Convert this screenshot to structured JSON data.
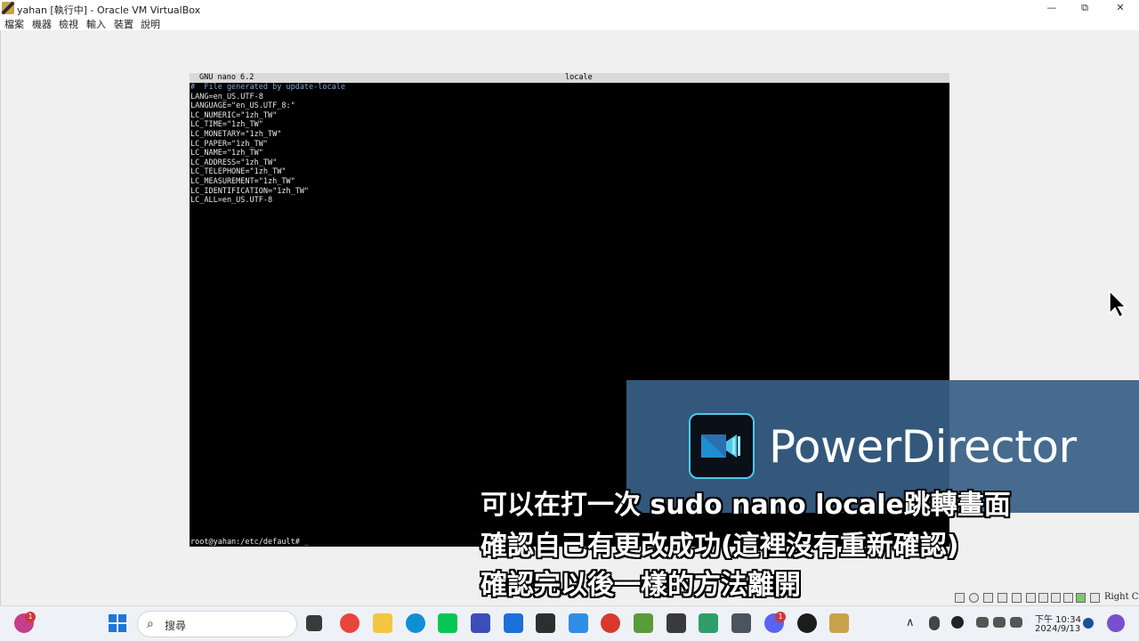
{
  "window": {
    "title": "yahan [執行中] - Oracle VM VirtualBox",
    "minimize_icon": "minimize-icon",
    "restore_icon": "restore-icon",
    "close_icon": "close-icon",
    "minimize_glyph": "—",
    "restore_glyph": "⧉",
    "close_glyph": "✕"
  },
  "menu": [
    "檔案",
    "機器",
    "檢視",
    "輸入",
    "裝置",
    "說明"
  ],
  "nano": {
    "version": "GNU nano 6.2",
    "filename": "locale",
    "lines": [
      "#  File generated by update-locale",
      "LANG=en_US.UTF-8",
      "LANGUAGE=\"en_US.UTF_8:\"",
      "LC_NUMERIC=\"1zh_TW\"",
      "LC_TIME=\"1zh_TW\"",
      "LC_MONETARY=\"1zh_TW\"",
      "LC_PAPER=\"1zh_TW\"",
      "LC_NAME=\"1zh_TW\"",
      "LC_ADDRESS=\"1zh_TW\"",
      "LC_TELEPHONE=\"1zh_TW\"",
      "LC_MEASUREMENT=\"1zh_TW\"",
      "LC_IDENTIFICATION=\"1zh_TW\"",
      "LC_ALL=en_US.UTF-8"
    ],
    "prompt": "root@yahan:/etc/default# _"
  },
  "watermark": {
    "brand": "PowerDirector"
  },
  "subtitles": [
    "可以在打一次 sudo nano locale跳轉畫面",
    "確認自己有更改成功(這裡沒有重新確認)",
    "確認完以後一樣的方法離開"
  ],
  "vbox_status": {
    "host_key": "Right Ctrl"
  },
  "taskbar": {
    "search_placeholder": "搜尋",
    "search_glyph": "⌕",
    "chat_badge": "1",
    "discord_badge": "1",
    "tray_up_glyph": "∧",
    "tray_time": "下午 10:34",
    "tray_date": "2024/9/13",
    "colors": {
      "chrome": "#e8453c",
      "explorer": "#f4c542",
      "edge": "#0f8fd6",
      "line": "#06c755",
      "vscode": "#2f8ee4",
      "minecraft": "#5a9b3a"
    }
  }
}
